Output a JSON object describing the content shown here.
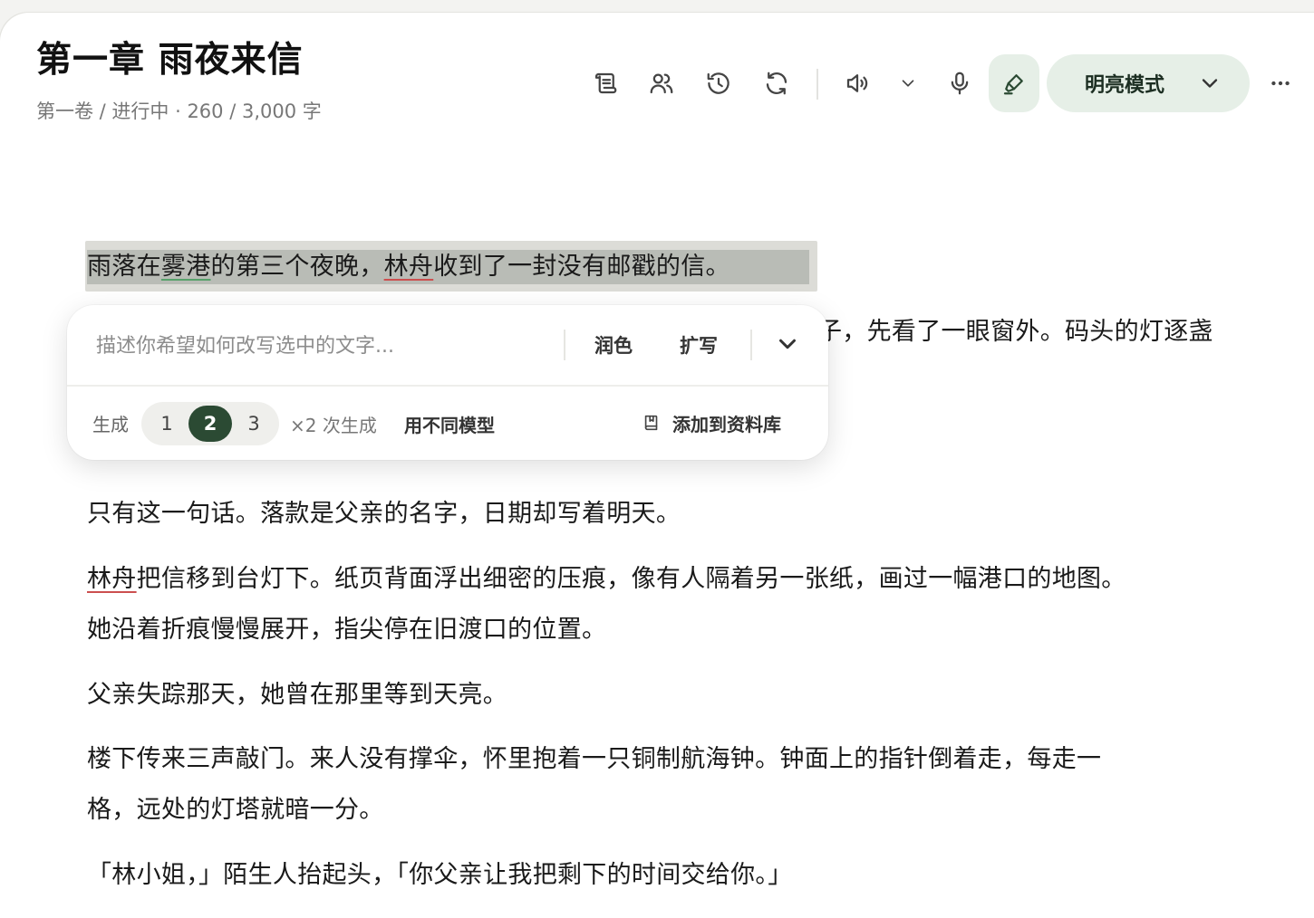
{
  "header": {
    "title": "第一章 雨夜来信",
    "meta": "第一卷 / 进行中 · 260 / 3,000 字"
  },
  "toolbar": {
    "icons": [
      "outline-icon",
      "characters-icon",
      "history-icon",
      "refresh-icon",
      "speaker-icon",
      "chevron-down-icon",
      "microphone-icon",
      "highlighter-icon",
      "more-icon"
    ],
    "mode_label": "明亮模式"
  },
  "editor": {
    "selected_line": {
      "before": "雨落在",
      "term1": "雾港",
      "middle": "的第三个夜晚，",
      "term2": "林舟",
      "after": "收到了一封没有邮戳的信。"
    },
    "partial_line": "子，先看了一眼窗外。码头的灯逐盏",
    "para3": "只有这一句话。落款是父亲的名字，日期却写着明天。",
    "para4": {
      "name": "林舟",
      "line1_rest": "把信移到台灯下。纸页背面浮出细密的压痕，像有人隔着另一张纸，画过一幅港口的地图。",
      "line2": "她沿着折痕慢慢展开，指尖停在旧渡口的位置。"
    },
    "para5": "父亲失踪那天，她曾在那里等到天亮。",
    "para6": {
      "line1": "楼下传来三声敲门。来人没有撑伞，怀里抱着一只铜制航海钟。钟面上的指针倒着走，每走一",
      "line2": "格，远处的灯塔就暗一分。"
    },
    "para7": "「林小姐，」陌生人抬起头，「你父亲让我把剩下的时间交给你。」"
  },
  "rewrite_popup": {
    "placeholder": "描述你希望如何改写选中的文字...",
    "polish_label": "润色",
    "expand_label": "扩写",
    "generate_label": "生成",
    "counts": [
      "1",
      "2",
      "3"
    ],
    "selected_count": "2",
    "times_label": "×2 次生成",
    "different_model_label": "用不同模型",
    "add_to_library_label": "添加到资料库"
  },
  "colors": {
    "accent_dark_green": "#2b4a33",
    "accent_light_green": "#e6efe7",
    "underline_green": "#57a26b",
    "underline_red": "#cc4f4f",
    "selection_gray": "#b9bcb6"
  }
}
